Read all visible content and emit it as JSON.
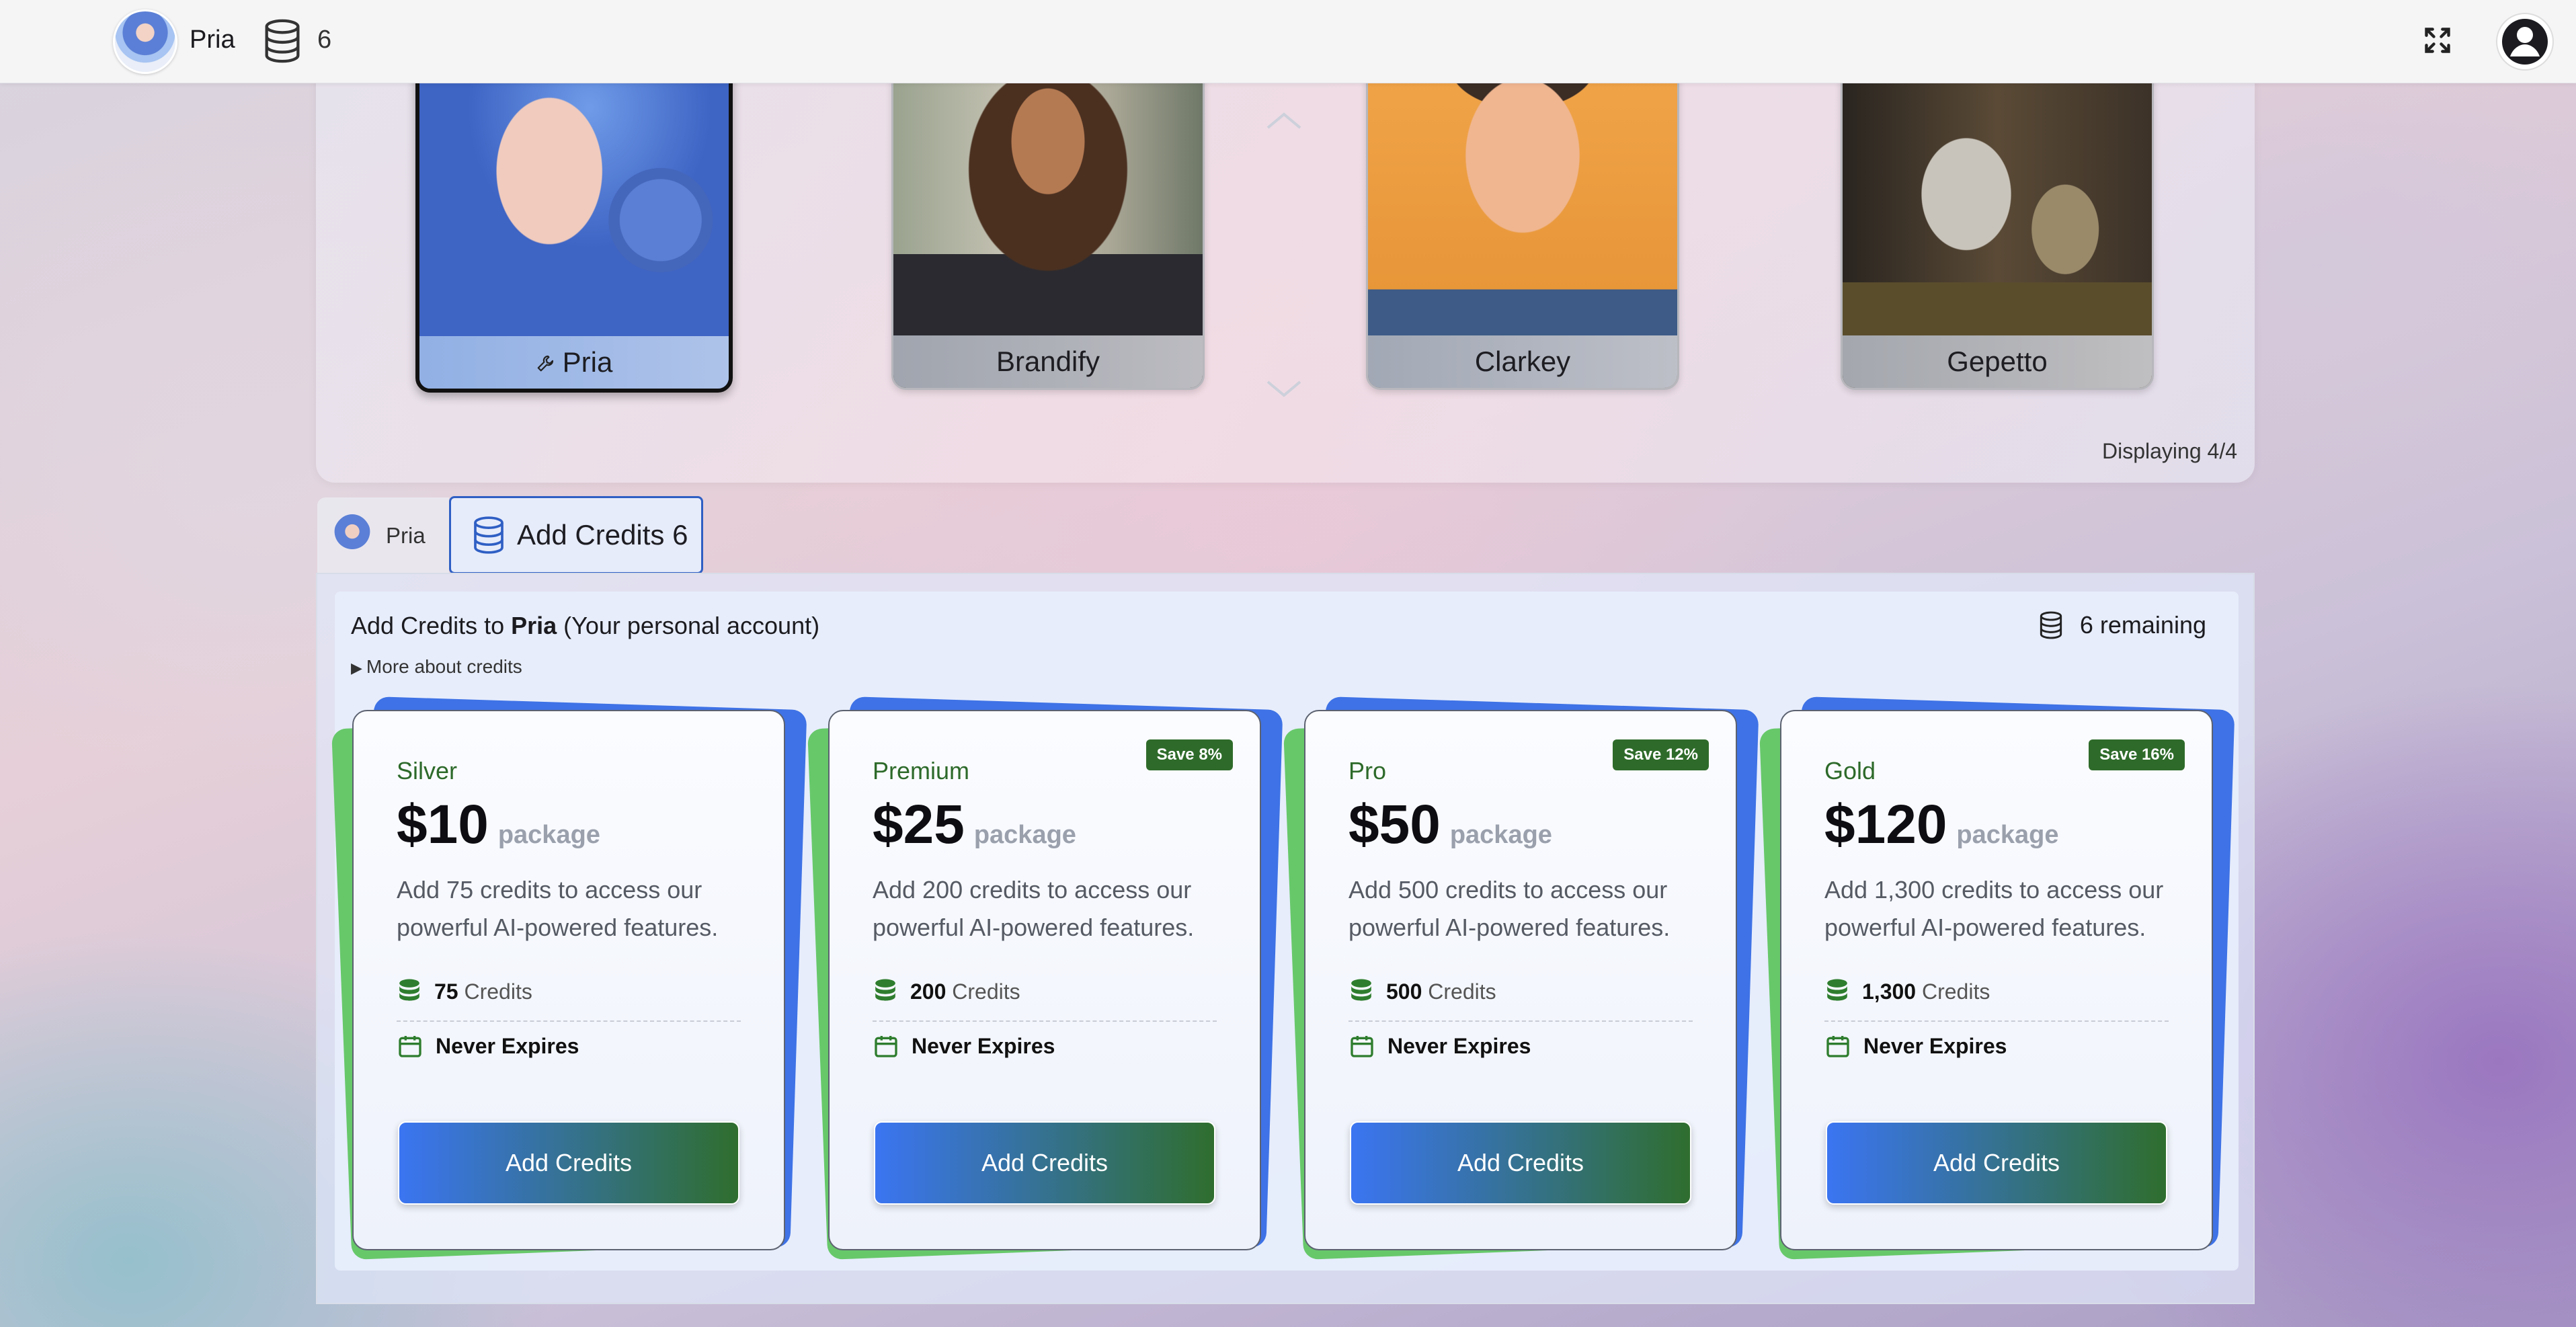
{
  "topbar": {
    "user_name": "Pria",
    "credit_count": "6"
  },
  "characters": {
    "items": [
      {
        "label": "Pria",
        "selected": true
      },
      {
        "label": "Brandify",
        "selected": false
      },
      {
        "label": "Clarkey",
        "selected": false
      },
      {
        "label": "Gepetto",
        "selected": false
      }
    ],
    "displaying": "Displaying 4/4"
  },
  "tabs": {
    "pria": "Pria",
    "add_credits": "Add Credits 6"
  },
  "credits": {
    "title_prefix": "Add Credits to ",
    "title_name": "Pria",
    "title_suffix": " (Your personal account)",
    "remaining": "6 remaining",
    "more_label": "More about credits",
    "price_suffix": "package",
    "expires_label": "Never Expires",
    "credits_word": "Credits",
    "button_label": "Add Credits",
    "packages": [
      {
        "tier": "Silver",
        "price": "$10",
        "save": "",
        "description": "Add 75 credits to access our powerful AI-powered features.",
        "credits": "75"
      },
      {
        "tier": "Premium",
        "price": "$25",
        "save": "Save 8%",
        "description": "Add 200 credits to access our powerful AI-powered features.",
        "credits": "200"
      },
      {
        "tier": "Pro",
        "price": "$50",
        "save": "Save 12%",
        "description": "Add 500 credits to access our powerful AI-powered features.",
        "credits": "500"
      },
      {
        "tier": "Gold",
        "price": "$120",
        "save": "Save 16%",
        "description": "Add 1,300 credits to access our powerful AI-powered features.",
        "credits": "1,300"
      }
    ]
  },
  "colors": {
    "accent_blue": "#3b75f2",
    "accent_green": "#2e6b2a",
    "card_green": "#67c86a"
  }
}
